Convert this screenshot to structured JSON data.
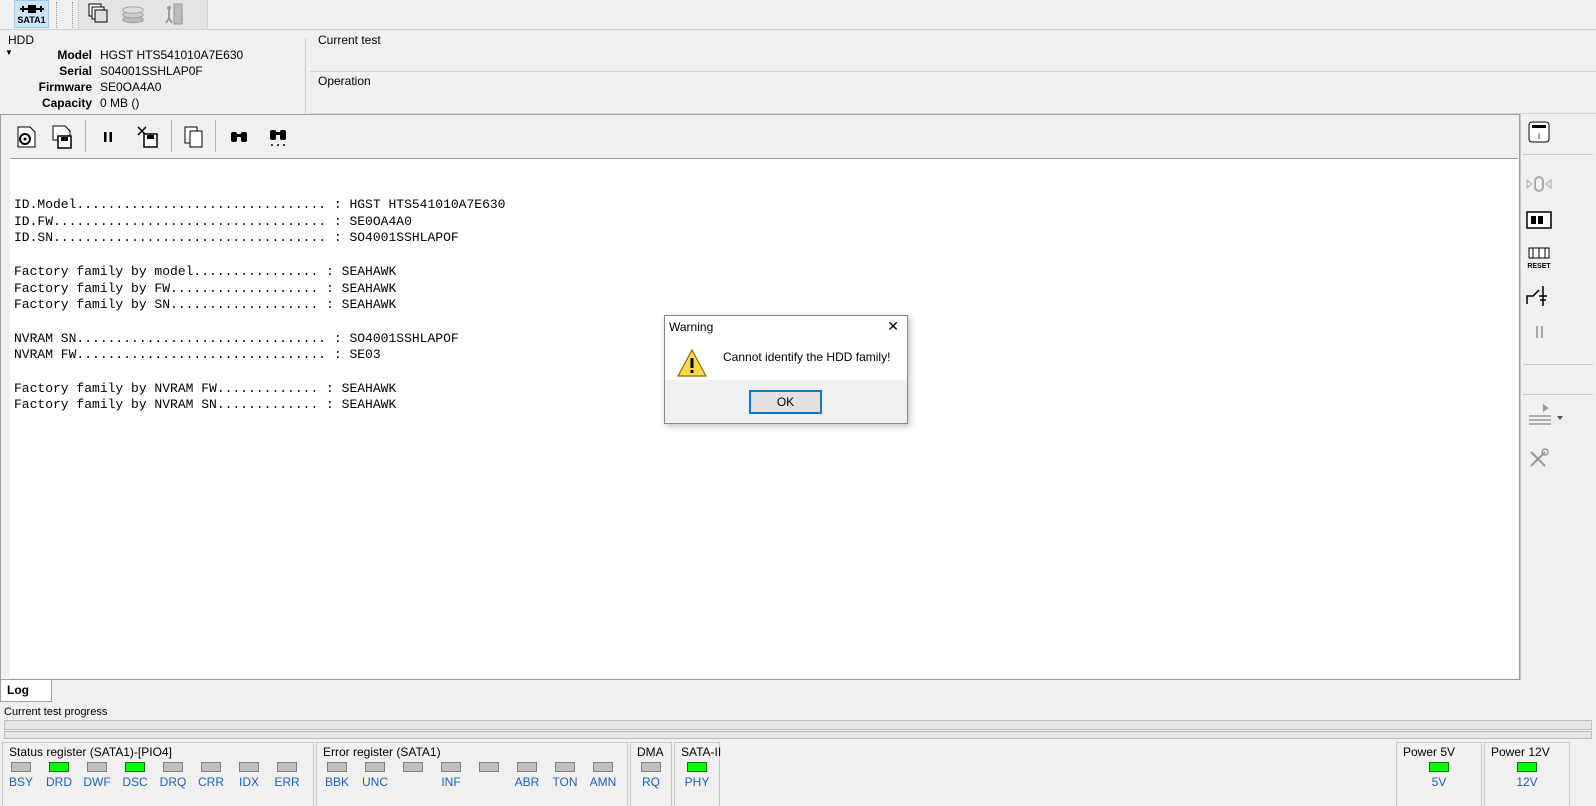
{
  "toolbar": {
    "sata_label": "SATA1"
  },
  "hdd": {
    "group_title": "HDD",
    "model_label": "Model",
    "model": "HGST HTS541010A7E630",
    "serial_label": "Serial",
    "serial": "S04001SSHLAP0F",
    "firmware_label": "Firmware",
    "firmware": "SE0OA4A0",
    "capacity_label": "Capacity",
    "capacity": "0 MB ()"
  },
  "test": {
    "current_test_label": "Current test",
    "operation_label": "Operation"
  },
  "log": {
    "text": "ID.Model................................ : HGST HTS541010A7E630\nID.FW................................... : SE0OA4A0\nID.SN................................... : SO4001SSHLAPOF\n\nFactory family by model................ : SEAHAWK\nFactory family by FW................... : SEAHAWK\nFactory family by SN................... : SEAHAWK\n\nNVRAM SN................................ : SO4001SSHLAPOF\nNVRAM FW................................ : SE03\n\nFactory family by NVRAM FW............. : SEAHAWK\nFactory family by NVRAM SN............. : SEAHAWK",
    "tab_label": "Log"
  },
  "dialog": {
    "title": "Warning",
    "message": "Cannot identify the HDD family!",
    "ok_label": "OK",
    "close_glyph": "✕"
  },
  "right_panel": {
    "reset_label": "RESET"
  },
  "progress": {
    "label": "Current test progress",
    "value": 0
  },
  "status_register": {
    "title": "Status register (SATA1)-[PIO4]",
    "bits": [
      {
        "label": "BSY",
        "on": false
      },
      {
        "label": "DRD",
        "on": true
      },
      {
        "label": "DWF",
        "on": false
      },
      {
        "label": "DSC",
        "on": true
      },
      {
        "label": "DRQ",
        "on": false
      },
      {
        "label": "CRR",
        "on": false
      },
      {
        "label": "IDX",
        "on": false
      },
      {
        "label": "ERR",
        "on": false
      }
    ]
  },
  "error_register": {
    "title": "Error register (SATA1)",
    "bits": [
      {
        "label": "BBK",
        "on": false
      },
      {
        "label": "UNC",
        "on": false
      },
      {
        "label": "",
        "on": false
      },
      {
        "label": "INF",
        "on": false
      },
      {
        "label": "",
        "on": false
      },
      {
        "label": "ABR",
        "on": false
      },
      {
        "label": "TON",
        "on": false
      },
      {
        "label": "AMN",
        "on": false
      }
    ]
  },
  "dma": {
    "title": "DMA",
    "label": "RQ",
    "on": false
  },
  "sata2": {
    "title": "SATA-II",
    "label": "PHY",
    "on": true
  },
  "power5": {
    "title": "Power 5V",
    "label": "5V",
    "on": true
  },
  "power12": {
    "title": "Power 12V",
    "label": "12V",
    "on": true
  },
  "colors": {
    "led_on": "#00ff00",
    "led_off": "#c0c0c0",
    "label_blue": "#1f5fbf"
  }
}
